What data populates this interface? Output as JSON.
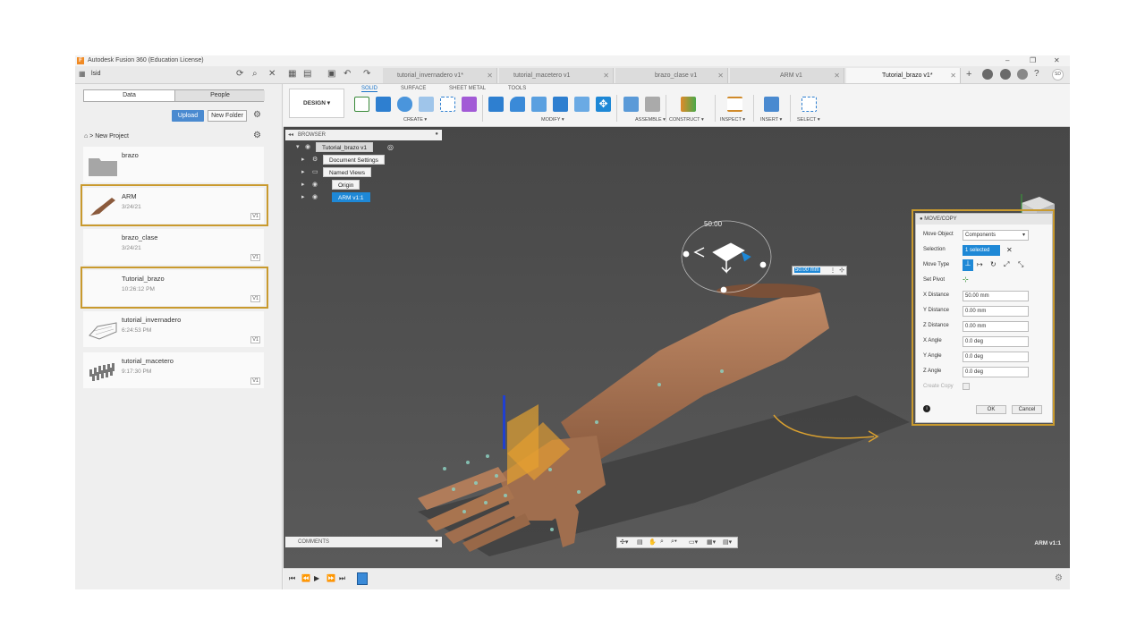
{
  "window": {
    "title": "Autodesk Fusion 360 (Education License)"
  },
  "topbar": {
    "user": "lsid",
    "tabs": [
      {
        "label": "tutorial_invernadero v1*"
      },
      {
        "label": "tutorial_macetero v1"
      },
      {
        "label": "brazo_clase v1"
      },
      {
        "label": "ARM v1"
      },
      {
        "label": "Tutorial_brazo v1*"
      }
    ],
    "avatar": "SD"
  },
  "datapanel": {
    "tab_data": "Data",
    "tab_people": "People",
    "upload": "Upload",
    "new_folder": "New Folder",
    "breadcrumb": "New Project",
    "items": [
      {
        "name": "brazo",
        "date": "",
        "version": ""
      },
      {
        "name": "ARM",
        "date": "3/24/21",
        "version": "V1"
      },
      {
        "name": "brazo_clase",
        "date": "3/24/21",
        "version": "V1"
      },
      {
        "name": "Tutorial_brazo",
        "date": "10:26:12 PM",
        "version": "V1"
      },
      {
        "name": "tutorial_invernadero",
        "date": "6:24:53 PM",
        "version": "V1"
      },
      {
        "name": "tutorial_macetero",
        "date": "9:17:30 PM",
        "version": "V1"
      }
    ]
  },
  "toolbar": {
    "workspace": "DESIGN",
    "tabs": [
      "SOLID",
      "SURFACE",
      "SHEET METAL",
      "TOOLS"
    ],
    "groups": [
      "CREATE",
      "MODIFY",
      "ASSEMBLE",
      "CONSTRUCT",
      "INSPECT",
      "INSERT",
      "SELECT"
    ]
  },
  "browser": {
    "title": "BROWSER",
    "root": "Tutorial_brazo v1",
    "nodes": [
      "Document Settings",
      "Named Views",
      "Origin",
      "ARM v1:1"
    ]
  },
  "viewport": {
    "manip_value": "50.00",
    "distance_input": "50.00 mm",
    "component_label": "ARM v1:1",
    "comments": "COMMENTS"
  },
  "dialog": {
    "title": "MOVE/COPY",
    "move_object_label": "Move Object",
    "move_object_value": "Components",
    "selection_label": "Selection",
    "selection_value": "1 selected",
    "move_type_label": "Move Type",
    "set_pivot_label": "Set Pivot",
    "x_distance_label": "X Distance",
    "x_distance": "50.00 mm",
    "y_distance_label": "Y Distance",
    "y_distance": "0.00 mm",
    "z_distance_label": "Z Distance",
    "z_distance": "0.00 mm",
    "x_angle_label": "X Angle",
    "x_angle": "0.0 deg",
    "y_angle_label": "Y Angle",
    "y_angle": "0.0 deg",
    "z_angle_label": "Z Angle",
    "z_angle": "0.0 deg",
    "create_copy_label": "Create Copy",
    "ok": "OK",
    "cancel": "Cancel"
  },
  "colors": {
    "accent": "#1e88d6",
    "highlight": "#c99a2e",
    "model": "#a87858"
  }
}
